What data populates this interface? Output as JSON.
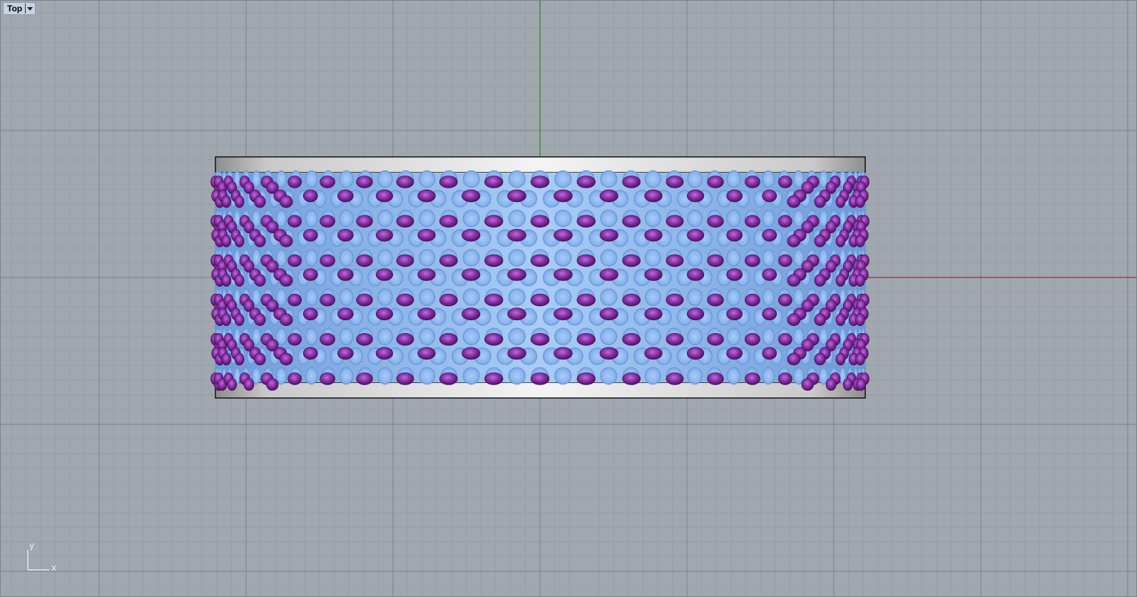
{
  "viewport": {
    "name": "Top"
  },
  "axis_icon": {
    "x_label": "x",
    "y_label": "y"
  },
  "colors": {
    "background": "#a1a7ae",
    "grid_minor": "#979da4",
    "grid_major": "#7c8288",
    "x_axis": "#a32a2a",
    "y_axis": "#2b8a2b",
    "gem_purple": "#8a3aa8",
    "gem_blue": "#8db8f0",
    "metal_band": "#d8d8d8"
  },
  "model": {
    "description_icon": "ring-band-with-gem-setting",
    "rows": 11
  }
}
